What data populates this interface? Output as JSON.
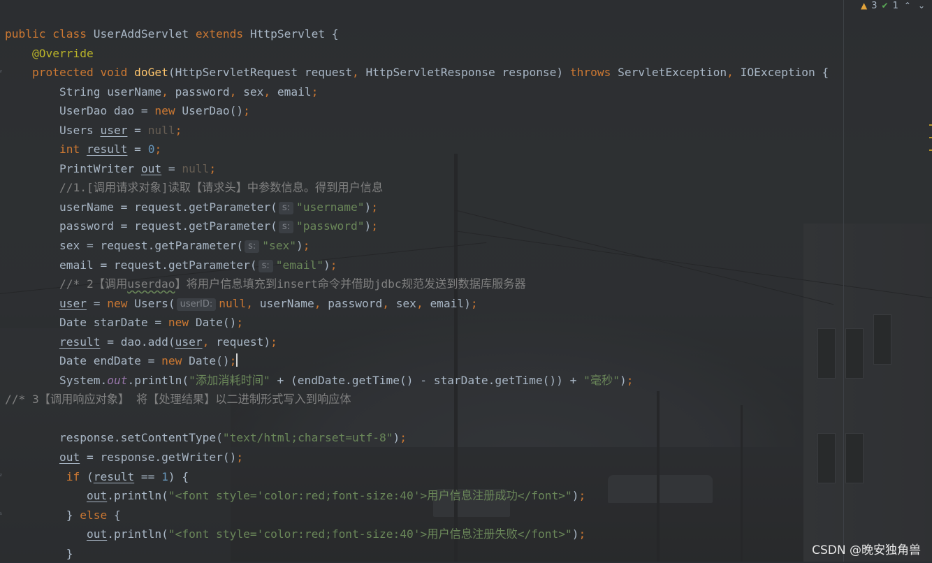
{
  "inspection": {
    "warnings": "3",
    "ok": "1"
  },
  "code_lines": [
    {
      "indent": 0,
      "tokens": [
        [
          "kw",
          "public class "
        ],
        [
          "plain",
          "UserAddServlet "
        ],
        [
          "kw",
          "extends "
        ],
        [
          "plain",
          "HttpServlet {"
        ]
      ]
    },
    {
      "indent": 1,
      "tokens": [
        [
          "ann",
          "@Override"
        ]
      ]
    },
    {
      "indent": 1,
      "tokens": [
        [
          "kw",
          "protected void "
        ],
        [
          "fn",
          "doGet"
        ],
        [
          "plain",
          "(HttpServletRequest request"
        ],
        [
          "kw",
          ", "
        ],
        [
          "plain",
          "HttpServletResponse response) "
        ],
        [
          "kw",
          "throws "
        ],
        [
          "plain",
          "ServletException"
        ],
        [
          "kw",
          ", "
        ],
        [
          "plain",
          "IOException {"
        ]
      ]
    },
    {
      "indent": 2,
      "tokens": [
        [
          "plain",
          "String userName"
        ],
        [
          "kw",
          ", "
        ],
        [
          "plain",
          "password"
        ],
        [
          "kw",
          ", "
        ],
        [
          "plain",
          "sex"
        ],
        [
          "kw",
          ", "
        ],
        [
          "plain",
          "email"
        ],
        [
          "kw",
          ";"
        ]
      ]
    },
    {
      "indent": 2,
      "tokens": [
        [
          "plain",
          "UserDao dao = "
        ],
        [
          "kw",
          "new "
        ],
        [
          "plain",
          "UserDao()"
        ],
        [
          "kw",
          ";"
        ]
      ]
    },
    {
      "indent": 2,
      "tokens": [
        [
          "plain",
          "Users "
        ],
        [
          "ul",
          "user"
        ],
        [
          "plain",
          " = "
        ],
        [
          "nul",
          "null"
        ],
        [
          "kw",
          ";"
        ]
      ]
    },
    {
      "indent": 2,
      "tokens": [
        [
          "kw",
          "int "
        ],
        [
          "ul",
          "result"
        ],
        [
          "plain",
          " = "
        ],
        [
          "num",
          "0"
        ],
        [
          "kw",
          ";"
        ]
      ]
    },
    {
      "indent": 2,
      "tokens": [
        [
          "plain",
          "PrintWriter "
        ],
        [
          "ul",
          "out"
        ],
        [
          "plain",
          " = "
        ],
        [
          "nul",
          "null"
        ],
        [
          "kw",
          ";"
        ]
      ]
    },
    {
      "indent": 2,
      "tokens": [
        [
          "cmt",
          "//1.[调用请求对象]读取【请求头】中参数信息。得到用户信息"
        ]
      ]
    },
    {
      "indent": 2,
      "tokens": [
        [
          "plain",
          "userName = request.getParameter("
        ],
        [
          "hint",
          "s:"
        ],
        [
          "str",
          "\"username\""
        ],
        [
          "plain",
          ")"
        ],
        [
          "kw",
          ";"
        ]
      ]
    },
    {
      "indent": 2,
      "tokens": [
        [
          "plain",
          "password = request.getParameter("
        ],
        [
          "hint",
          "s:"
        ],
        [
          "str",
          "\"password\""
        ],
        [
          "plain",
          ")"
        ],
        [
          "kw",
          ";"
        ]
      ]
    },
    {
      "indent": 2,
      "tokens": [
        [
          "plain",
          "sex = request.getParameter("
        ],
        [
          "hint",
          "s:"
        ],
        [
          "str",
          "\"sex\""
        ],
        [
          "plain",
          ")"
        ],
        [
          "kw",
          ";"
        ]
      ]
    },
    {
      "indent": 2,
      "tokens": [
        [
          "plain",
          "email = request.getParameter("
        ],
        [
          "hint",
          "s:"
        ],
        [
          "str",
          "\"email\""
        ],
        [
          "plain",
          ")"
        ],
        [
          "kw",
          ";"
        ]
      ]
    },
    {
      "indent": 2,
      "tokens": [
        [
          "cmt",
          "//* 2【调用"
        ],
        [
          "cmtul",
          "userdao"
        ],
        [
          "cmt",
          "】将用户信息填充到insert命令并借助jdbc规范发送到数据库服务器"
        ]
      ]
    },
    {
      "indent": 2,
      "tokens": [
        [
          "ul",
          "user"
        ],
        [
          "plain",
          " = "
        ],
        [
          "kw",
          "new "
        ],
        [
          "plain",
          "Users("
        ],
        [
          "hint",
          "userID:"
        ],
        [
          "kw",
          "null, "
        ],
        [
          "plain",
          "userName"
        ],
        [
          "kw",
          ", "
        ],
        [
          "plain",
          "password"
        ],
        [
          "kw",
          ", "
        ],
        [
          "plain",
          "sex"
        ],
        [
          "kw",
          ", "
        ],
        [
          "plain",
          "email)"
        ],
        [
          "kw",
          ";"
        ]
      ]
    },
    {
      "indent": 2,
      "tokens": [
        [
          "plain",
          "Date starDate = "
        ],
        [
          "kw",
          "new "
        ],
        [
          "plain",
          "Date()"
        ],
        [
          "kw",
          ";"
        ]
      ]
    },
    {
      "indent": 2,
      "tokens": [
        [
          "ul",
          "result"
        ],
        [
          "plain",
          " = dao.add("
        ],
        [
          "ul",
          "user"
        ],
        [
          "kw",
          ", "
        ],
        [
          "plain",
          "request)"
        ],
        [
          "kw",
          ";"
        ]
      ]
    },
    {
      "indent": 2,
      "tokens": [
        [
          "plain",
          "Date endDate = "
        ],
        [
          "kw",
          "new "
        ],
        [
          "plain",
          "Date()"
        ],
        [
          "kw",
          ";"
        ],
        [
          "caret",
          ""
        ]
      ]
    },
    {
      "indent": 2,
      "tokens": [
        [
          "plain",
          "System."
        ],
        [
          "sfield",
          "out"
        ],
        [
          "plain",
          ".println("
        ],
        [
          "str",
          "\"添加消耗时间\""
        ],
        [
          "plain",
          " + (endDate.getTime() - starDate.getTime()) + "
        ],
        [
          "str",
          "\"毫秒\""
        ],
        [
          "plain",
          ")"
        ],
        [
          "kw",
          ";"
        ]
      ]
    },
    {
      "indent": 0,
      "tokens": [
        [
          "cmt",
          "//* 3【调用响应对象】 将【处理结果】以二进制形式写入到响应体"
        ]
      ]
    },
    {
      "indent": 0,
      "tokens": []
    },
    {
      "indent": 2,
      "tokens": [
        [
          "plain",
          "response.setContentType("
        ],
        [
          "str",
          "\"text/html;charset=utf-8\""
        ],
        [
          "plain",
          ")"
        ],
        [
          "kw",
          ";"
        ]
      ]
    },
    {
      "indent": 2,
      "tokens": [
        [
          "ul",
          "out"
        ],
        [
          "plain",
          " = response.getWriter()"
        ],
        [
          "kw",
          ";"
        ]
      ]
    },
    {
      "indent": 2,
      "tokens": [
        [
          "kw",
          " if "
        ],
        [
          "plain",
          "("
        ],
        [
          "ul",
          "result"
        ],
        [
          "plain",
          " == "
        ],
        [
          "num",
          "1"
        ],
        [
          "plain",
          ") {"
        ]
      ]
    },
    {
      "indent": 3,
      "tokens": [
        [
          "ul",
          "out"
        ],
        [
          "plain",
          ".println("
        ],
        [
          "str",
          "\"<font style='color:red;font-size:40'>用户信息注册成功</font>\""
        ],
        [
          "plain",
          ")"
        ],
        [
          "kw",
          ";"
        ]
      ]
    },
    {
      "indent": 2,
      "tokens": [
        [
          "plain",
          " } "
        ],
        [
          "kw",
          "else "
        ],
        [
          "plain",
          "{"
        ]
      ]
    },
    {
      "indent": 3,
      "tokens": [
        [
          "ul",
          "out"
        ],
        [
          "plain",
          ".println("
        ],
        [
          "str",
          "\"<font style='color:red;font-size:40'>用户信息注册失败</font>\""
        ],
        [
          "plain",
          ")"
        ],
        [
          "kw",
          ";"
        ]
      ]
    },
    {
      "indent": 2,
      "tokens": [
        [
          "plain",
          " }"
        ]
      ]
    }
  ],
  "watermark": "CSDN @晚安独角兽",
  "colors": {
    "keyword": "#cc7832",
    "string": "#6a8759",
    "comment": "#808080",
    "number": "#6897bb",
    "annotation": "#bbb529",
    "function": "#ffc66d",
    "text": "#a9b7c6"
  }
}
